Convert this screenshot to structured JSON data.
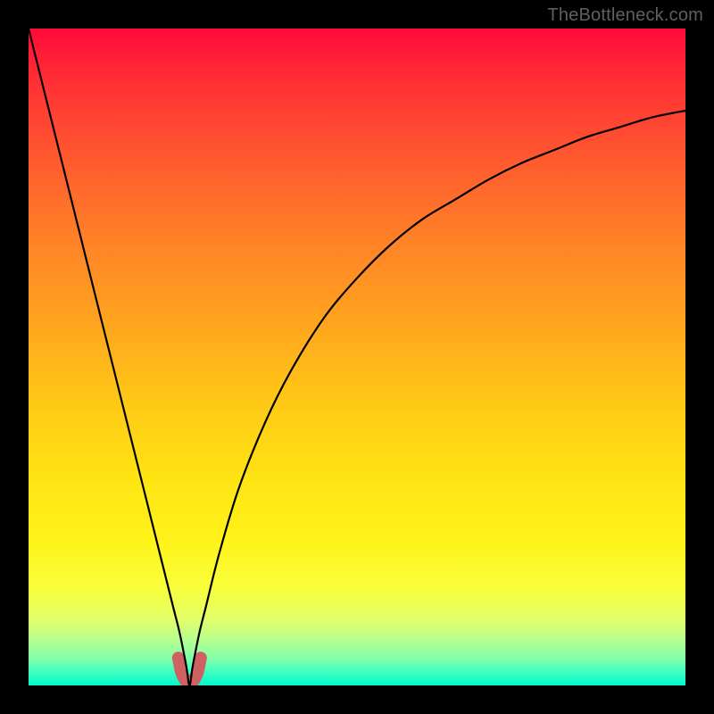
{
  "watermark": "TheBottleneck.com",
  "colors": {
    "frame": "#000000",
    "curve": "#000000",
    "marker": "#ce6262",
    "gradient_top": "#ff0a3a",
    "gradient_bottom": "#00f9c9"
  },
  "chart_data": {
    "type": "line",
    "title": "",
    "xlabel": "",
    "ylabel": "",
    "xlim": [
      0,
      100
    ],
    "ylim": [
      0,
      100
    ],
    "grid": false,
    "legend": false,
    "note": "V-shaped bottleneck / mismatch curve. y=0 at x≈24.5. x/y are percent of the visible plot area (0 at left/bottom, 100 at right/top). Values estimated from pixels.",
    "series": [
      {
        "name": "curve",
        "x": [
          0,
          3,
          6,
          9,
          12,
          15,
          18,
          20,
          22,
          23,
          24,
          24.5,
          25,
          26,
          27,
          29,
          32,
          36,
          40,
          45,
          50,
          55,
          60,
          65,
          70,
          75,
          80,
          85,
          90,
          95,
          100
        ],
        "y": [
          100,
          88,
          76,
          64,
          52,
          40,
          28,
          20,
          12,
          8,
          3,
          0,
          3,
          8,
          12,
          20,
          30,
          40,
          48,
          56,
          62,
          67,
          71,
          74,
          77,
          79.5,
          81.5,
          83.5,
          85,
          86.5,
          87.5
        ]
      },
      {
        "name": "rounded-minimum-marker",
        "x": [
          22.8,
          23.3,
          24.0,
          24.5,
          25.0,
          25.7,
          26.2
        ],
        "y": [
          4.2,
          1.9,
          0.6,
          0.3,
          0.6,
          1.9,
          4.2
        ]
      }
    ]
  }
}
